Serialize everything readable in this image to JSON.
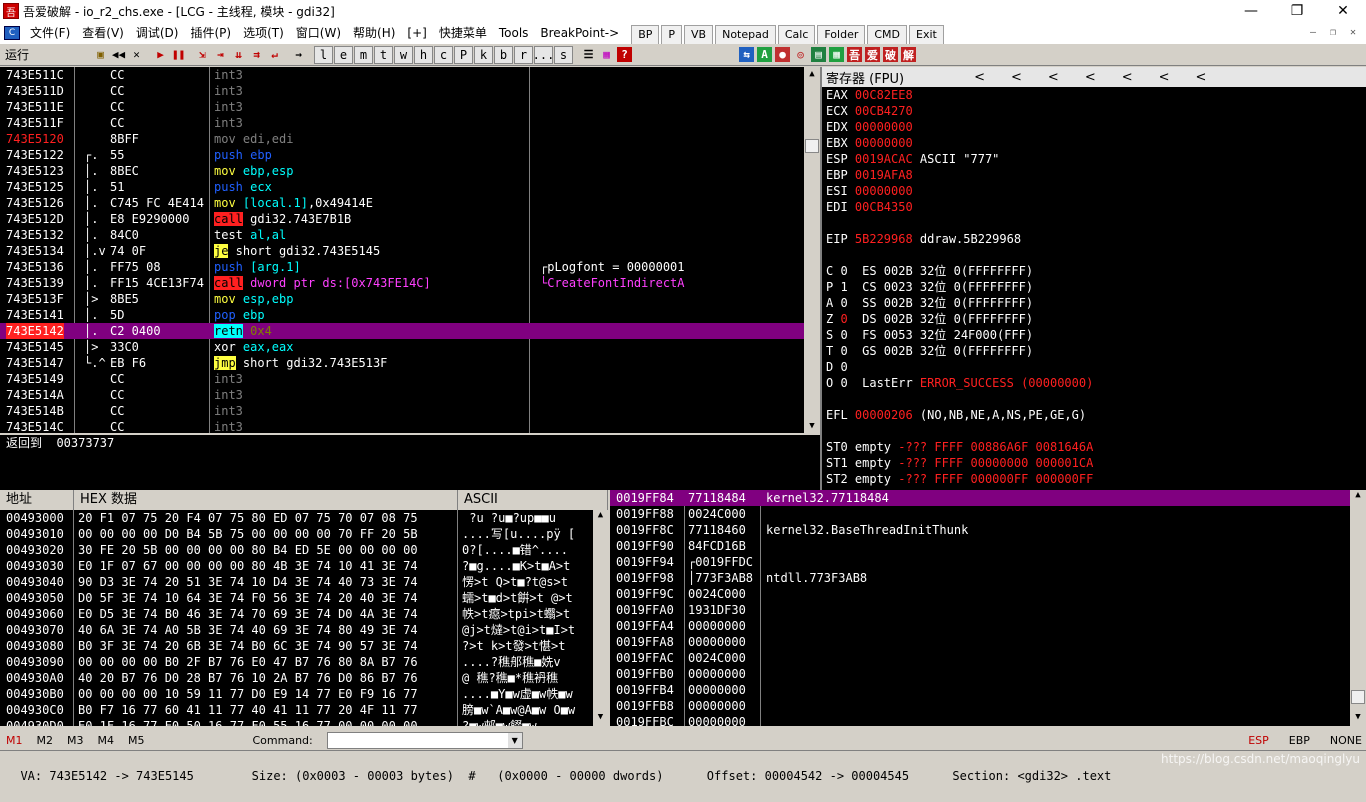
{
  "window": {
    "title": "吾爱破解 - io_r2_chs.exe - [LCG - 主线程, 模块 - gdi32]",
    "app_icon": "吾",
    "min": "—",
    "max": "❐",
    "close": "✕"
  },
  "menu": {
    "items": [
      "文件(F)",
      "查看(V)",
      "调试(D)",
      "插件(P)",
      "选项(T)",
      "窗口(W)",
      "帮助(H)",
      "[+]",
      "快捷菜单",
      "Tools",
      "BreakPoint->"
    ],
    "buttons": [
      "BP",
      "P",
      "VB",
      "Notepad",
      "Calc",
      "Folder",
      "CMD",
      "Exit"
    ]
  },
  "toolbar": {
    "state": "运行",
    "letters": [
      "l",
      "e",
      "m",
      "t",
      "w",
      "h",
      "c",
      "P",
      "k",
      "b",
      "r",
      "...",
      "s"
    ],
    "right_icons": [
      "吾",
      "爱",
      "破",
      "解"
    ]
  },
  "cpu": {
    "rows": [
      {
        "addr": "743E511C",
        "mark": "",
        "hex": "CC",
        "asm": [
          {
            "t": "int3",
            "c": "#808080"
          }
        ],
        "cmt": ""
      },
      {
        "addr": "743E511D",
        "mark": "",
        "hex": "CC",
        "asm": [
          {
            "t": "int3",
            "c": "#808080"
          }
        ],
        "cmt": ""
      },
      {
        "addr": "743E511E",
        "mark": "",
        "hex": "CC",
        "asm": [
          {
            "t": "int3",
            "c": "#808080"
          }
        ],
        "cmt": ""
      },
      {
        "addr": "743E511F",
        "mark": "",
        "hex": "CC",
        "asm": [
          {
            "t": "int3",
            "c": "#808080"
          }
        ],
        "cmt": ""
      },
      {
        "addr": "743E5120",
        "addr_color": "#ff2020",
        "mark": "",
        "hex": "8BFF",
        "asm": [
          {
            "t": "mov edi,edi",
            "c": "#808080"
          }
        ],
        "cmt": ""
      },
      {
        "addr": "743E5122",
        "mark": "┌.",
        "hex": "55",
        "asm": [
          {
            "t": "push ebp",
            "c": "#2060ff"
          }
        ],
        "cmt": ""
      },
      {
        "addr": "743E5123",
        "mark": "│.",
        "hex": "8BEC",
        "asm": [
          {
            "t": "mov ",
            "c": "#ffff40"
          },
          {
            "t": "ebp,esp",
            "c": "#00ffff"
          }
        ],
        "cmt": ""
      },
      {
        "addr": "743E5125",
        "mark": "│.",
        "hex": "51",
        "asm": [
          {
            "t": "push ",
            "c": "#2060ff"
          },
          {
            "t": "ecx",
            "c": "#00ffff"
          }
        ],
        "cmt": ""
      },
      {
        "addr": "743E5126",
        "mark": "│.",
        "hex": "C745 FC 4E414",
        "asm": [
          {
            "t": "mov ",
            "c": "#ffff40"
          },
          {
            "t": "[local.1]",
            "c": "#00ffff"
          },
          {
            "t": ",0x49414E",
            "c": "#ffffff"
          }
        ],
        "cmt": ""
      },
      {
        "addr": "743E512D",
        "mark": "│.",
        "hex": "E8 E9290000",
        "asm": [
          {
            "t": "call",
            "c": "#000000",
            "bg": "#ff2020"
          },
          {
            "t": " gdi32.743E7B1B",
            "c": "#ffffff"
          }
        ],
        "cmt": ""
      },
      {
        "addr": "743E5132",
        "mark": "│.",
        "hex": "84C0",
        "asm": [
          {
            "t": "test ",
            "c": "#ffffff"
          },
          {
            "t": "al,al",
            "c": "#00ffff"
          }
        ],
        "cmt": ""
      },
      {
        "addr": "743E5134",
        "mark": "│.v",
        "hex": "74 0F",
        "asm": [
          {
            "t": "je",
            "c": "#000000",
            "bg": "#ffff40"
          },
          {
            "t": " short gdi32.743E5145",
            "c": "#ffffff"
          }
        ],
        "cmt": ""
      },
      {
        "addr": "743E5136",
        "mark": "│.",
        "hex": "FF75 08",
        "asm": [
          {
            "t": "push ",
            "c": "#2060ff"
          },
          {
            "t": "[arg.1]",
            "c": "#00ffff"
          }
        ],
        "cmt": "┌pLogfont = 00000001",
        "cmt_color": "#ffffff"
      },
      {
        "addr": "743E5139",
        "mark": "│.",
        "hex": "FF15 4CE13F74",
        "asm": [
          {
            "t": "call",
            "c": "#000000",
            "bg": "#ff2020"
          },
          {
            "t": " dword ptr ds:[0x743FE14C]",
            "c": "#ff40ff"
          }
        ],
        "cmt": "└CreateFontIndirectA",
        "cmt_color": "#ff40ff"
      },
      {
        "addr": "743E513F",
        "mark": "│>",
        "hex": "8BE5",
        "asm": [
          {
            "t": "mov ",
            "c": "#ffff40"
          },
          {
            "t": "esp,ebp",
            "c": "#00ffff"
          }
        ],
        "cmt": ""
      },
      {
        "addr": "743E5141",
        "mark": "│.",
        "hex": "5D",
        "asm": [
          {
            "t": "pop ",
            "c": "#2060ff"
          },
          {
            "t": "ebp",
            "c": "#00ffff"
          }
        ],
        "cmt": ""
      },
      {
        "addr": "743E5142",
        "addr_color": "#ff2020",
        "highlight": true,
        "mark": "│.",
        "hex": "C2 0400",
        "asm": [
          {
            "t": "retn",
            "c": "#000000",
            "bg": "#00ffff"
          },
          {
            "t": " 0x4",
            "c": "#808000"
          }
        ],
        "cmt": ""
      },
      {
        "addr": "743E5145",
        "mark": "│>",
        "hex": "33C0",
        "asm": [
          {
            "t": "xor ",
            "c": "#ffffff"
          },
          {
            "t": "eax,eax",
            "c": "#00ffff"
          }
        ],
        "cmt": ""
      },
      {
        "addr": "743E5147",
        "mark": "└.^",
        "hex": "EB F6",
        "asm": [
          {
            "t": "jmp",
            "c": "#000000",
            "bg": "#ffff40"
          },
          {
            "t": " short gdi32.743E513F",
            "c": "#ffffff"
          }
        ],
        "cmt": ""
      },
      {
        "addr": "743E5149",
        "mark": "",
        "hex": "CC",
        "asm": [
          {
            "t": "int3",
            "c": "#808080"
          }
        ],
        "cmt": ""
      },
      {
        "addr": "743E514A",
        "mark": "",
        "hex": "CC",
        "asm": [
          {
            "t": "int3",
            "c": "#808080"
          }
        ],
        "cmt": ""
      },
      {
        "addr": "743E514B",
        "mark": "",
        "hex": "CC",
        "asm": [
          {
            "t": "int3",
            "c": "#808080"
          }
        ],
        "cmt": ""
      },
      {
        "addr": "743E514C",
        "mark": "",
        "hex": "CC",
        "asm": [
          {
            "t": "int3",
            "c": "#808080"
          }
        ],
        "cmt": ""
      }
    ]
  },
  "info": {
    "text": "返回到  00373737"
  },
  "registers": {
    "title": "寄存器 (FPU)",
    "arrows": [
      "<",
      "<",
      "<",
      "<",
      "<",
      "<",
      "<"
    ],
    "lines": [
      [
        {
          "t": "EAX ",
          "c": "#ffffff"
        },
        {
          "t": "00C82EE8",
          "c": "#ff2020"
        }
      ],
      [
        {
          "t": "ECX ",
          "c": "#ffffff"
        },
        {
          "t": "00CB4270",
          "c": "#ff2020"
        }
      ],
      [
        {
          "t": "EDX ",
          "c": "#ffffff"
        },
        {
          "t": "00000000",
          "c": "#ff2020"
        }
      ],
      [
        {
          "t": "EBX ",
          "c": "#ffffff"
        },
        {
          "t": "00000000",
          "c": "#ff2020"
        }
      ],
      [
        {
          "t": "ESP ",
          "c": "#ffffff"
        },
        {
          "t": "0019ACAC",
          "c": "#ff2020"
        },
        {
          "t": " ASCII \"777\"",
          "c": "#ffffff"
        }
      ],
      [
        {
          "t": "EBP ",
          "c": "#ffffff"
        },
        {
          "t": "0019AFA8",
          "c": "#ff2020"
        }
      ],
      [
        {
          "t": "ESI ",
          "c": "#ffffff"
        },
        {
          "t": "00000000",
          "c": "#ff2020"
        }
      ],
      [
        {
          "t": "EDI ",
          "c": "#ffffff"
        },
        {
          "t": "00CB4350",
          "c": "#ff2020"
        }
      ],
      [
        {
          "t": "",
          "c": "#ffffff"
        }
      ],
      [
        {
          "t": "EIP ",
          "c": "#ffffff"
        },
        {
          "t": "5B229968",
          "c": "#ff2020"
        },
        {
          "t": " ddraw.5B229968",
          "c": "#ffffff"
        }
      ],
      [
        {
          "t": "",
          "c": "#ffffff"
        }
      ],
      [
        {
          "t": "C 0  ES 002B 32位 0(FFFFFFFF)",
          "c": "#ffffff"
        }
      ],
      [
        {
          "t": "P 1  CS 0023 32位 0(FFFFFFFF)",
          "c": "#ffffff"
        }
      ],
      [
        {
          "t": "A 0  SS 002B 32位 0(FFFFFFFF)",
          "c": "#ffffff"
        }
      ],
      [
        {
          "t": "Z ",
          "c": "#ffffff"
        },
        {
          "t": "0",
          "c": "#ff2020"
        },
        {
          "t": "  DS 002B 32位 0(FFFFFFFF)",
          "c": "#ffffff"
        }
      ],
      [
        {
          "t": "S 0  FS 0053 32位 24F000(FFF)",
          "c": "#ffffff"
        }
      ],
      [
        {
          "t": "T 0  GS 002B 32位 0(FFFFFFFF)",
          "c": "#ffffff"
        }
      ],
      [
        {
          "t": "D 0",
          "c": "#ffffff"
        }
      ],
      [
        {
          "t": "O 0  LastErr ",
          "c": "#ffffff"
        },
        {
          "t": "ERROR_SUCCESS (00000000)",
          "c": "#ff2020"
        }
      ],
      [
        {
          "t": "",
          "c": "#ffffff"
        }
      ],
      [
        {
          "t": "EFL ",
          "c": "#ffffff"
        },
        {
          "t": "00000206",
          "c": "#ff2020"
        },
        {
          "t": " (NO,NB,NE,A,NS,PE,GE,G)",
          "c": "#ffffff"
        }
      ],
      [
        {
          "t": "",
          "c": "#ffffff"
        }
      ],
      [
        {
          "t": "ST0 empty ",
          "c": "#ffffff"
        },
        {
          "t": "-??? FFFF 00886A6F 0081646A",
          "c": "#ff2020"
        }
      ],
      [
        {
          "t": "ST1 empty ",
          "c": "#ffffff"
        },
        {
          "t": "-??? FFFF 00000000 000001CA",
          "c": "#ff2020"
        }
      ],
      [
        {
          "t": "ST2 empty ",
          "c": "#ffffff"
        },
        {
          "t": "-??? FFFF 000000FF 000000FF",
          "c": "#ff2020"
        }
      ],
      [
        {
          "t": "ST3 empty ",
          "c": "#ffffff"
        },
        {
          "t": "-??? FFFF 00000000 00000000",
          "c": "#ff2020"
        }
      ],
      [
        {
          "t": "ST4 empty ",
          "c": "#ffffff"
        },
        {
          "t": "-??? FFFF 00000000 00000000",
          "c": "#ff2020"
        }
      ]
    ]
  },
  "dump": {
    "headers": [
      "地址",
      "HEX 数据",
      "ASCII"
    ],
    "rows": [
      {
        "addr": "00493000",
        "hex": "20 F1 07 75 20 F4 07 75 80 ED 07 75 70 07 08 75",
        "ascii": " ?u ?u■?up■■u"
      },
      {
        "addr": "00493010",
        "hex": "00 00 00 00 D0 B4 5B 75 00 00 00 00 70 FF 20 5B",
        "ascii": "....写[u....pÿ ["
      },
      {
        "addr": "00493020",
        "hex": "30 FE 20 5B 00 00 00 00 80 B4 ED 5E 00 00 00 00",
        "ascii": "0?[....■错^...."
      },
      {
        "addr": "00493030",
        "hex": "E0 1F 07 67 00 00 00 00 80 4B 3E 74 10 41 3E 74",
        "ascii": "?■g....■K>t■A>t"
      },
      {
        "addr": "00493040",
        "hex": "90 D3 3E 74 20 51 3E 74 10 D4 3E 74 40 73 3E 74",
        "ascii": "愣>t Q>t■?t@s>t"
      },
      {
        "addr": "00493050",
        "hex": "D0 5F 3E 74 10 64 3E 74 F0 56 3E 74 20 40 3E 74",
        "ascii": "蠕>t■d>t餠>t @>t"
      },
      {
        "addr": "00493060",
        "hex": "E0 D5 3E 74 B0 46 3E 74 70 69 3E 74 D0 4A 3E 74",
        "ascii": "帙>t癋>tpi>t蠮>t"
      },
      {
        "addr": "00493070",
        "hex": "40 6A 3E 74 A0 5B 3E 74 40 69 3E 74 80 49 3E 74",
        "ascii": "@j>t燵>t@i>t■I>t"
      },
      {
        "addr": "00493080",
        "hex": "B0 3F 3E 74 20 6B 3E 74 B0 6C 3E 74 90 57 3E 74",
        "ascii": "?>t k>t發>t愖>t"
      },
      {
        "addr": "00493090",
        "hex": "00 00 00 00 B0 2F B7 76 E0 47 B7 76 80 8A B7 76",
        "ascii": "....?穛郍穛■姺v"
      },
      {
        "addr": "004930A0",
        "hex": "40 20 B7 76 D0 28 B7 76 10 2A B7 76 D0 86 B7 76",
        "ascii": "@ 穛?穛■*穛袇穛"
      },
      {
        "addr": "004930B0",
        "hex": "00 00 00 00 10 59 11 77 D0 E9 14 77 E0 F9 16 77",
        "ascii": "....■Y■w虚■w帙■w"
      },
      {
        "addr": "004930C0",
        "hex": "B0 F7 16 77 60 41 11 77 40 41 11 77 20 4F 11 77",
        "ascii": "膀■w`A■w@A■w O■w"
      },
      {
        "addr": "004930D0",
        "hex": "E0 1F 16 77 E0 50 16 77 F0 55 16 77 00 00 00 00",
        "ascii": "?■w郟■w餟■w...."
      }
    ]
  },
  "stack": {
    "rows": [
      {
        "addr": "0019FF84",
        "val": "77118484",
        "cmt": "kernel32.77118484",
        "highlight": true
      },
      {
        "addr": "0019FF88",
        "val": "0024C000",
        "cmt": ""
      },
      {
        "addr": "0019FF8C",
        "val": "77118460",
        "cmt": "kernel32.BaseThreadInitThunk"
      },
      {
        "addr": "0019FF90",
        "val": "84FCD16B",
        "cmt": ""
      },
      {
        "addr": "0019FF94",
        "val": "┌0019FFDC",
        "cmt": ""
      },
      {
        "addr": "0019FF98",
        "val": "│773F3AB8",
        "cmt": "ntdll.773F3AB8"
      },
      {
        "addr": "0019FF9C",
        "val": "0024C000",
        "cmt": ""
      },
      {
        "addr": "0019FFA0",
        "val": "1931DF30",
        "cmt": ""
      },
      {
        "addr": "0019FFA4",
        "val": "00000000",
        "cmt": ""
      },
      {
        "addr": "0019FFA8",
        "val": "00000000",
        "cmt": ""
      },
      {
        "addr": "0019FFAC",
        "val": "0024C000",
        "cmt": ""
      },
      {
        "addr": "0019FFB0",
        "val": "00000000",
        "cmt": ""
      },
      {
        "addr": "0019FFB4",
        "val": "00000000",
        "cmt": ""
      },
      {
        "addr": "0019FFB8",
        "val": "00000000",
        "cmt": ""
      },
      {
        "addr": "0019FFBC",
        "val": "00000000",
        "cmt": ""
      }
    ]
  },
  "command_row": {
    "tabs": [
      "M1",
      "M2",
      "M3",
      "M4",
      "M5"
    ],
    "label": "Command:",
    "right": [
      "ESP",
      "EBP",
      "NONE"
    ]
  },
  "statusbar": {
    "text": "VA: 743E5142 -> 743E5145        Size: (0x0003 - 00003 bytes)  #   (0x0000 - 00000 dwords)      Offset: 00004542 -> 00004545      Section: <gdi32> .text",
    "watermark": "https://blog.csdn.net/maoqinglyu"
  },
  "colors": {
    "red": "#ff2020",
    "highlight": "#800080",
    "panel_bg": "#000000"
  }
}
